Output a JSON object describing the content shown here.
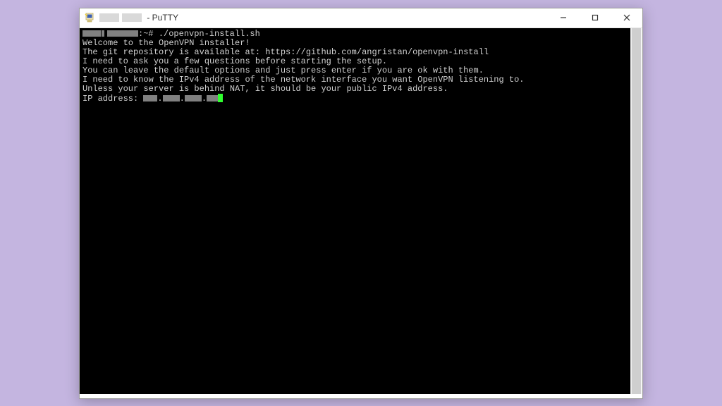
{
  "window": {
    "app_name": "PuTTY",
    "title_suffix": " - PuTTY"
  },
  "terminal": {
    "prompt_suffix": ":~# ",
    "command": "./openvpn-install.sh",
    "lines": [
      "Welcome to the OpenVPN installer!",
      "The git repository is available at: https://github.com/angristan/openvpn-install",
      "",
      "I need to ask you a few questions before starting the setup.",
      "You can leave the default options and just press enter if you are ok with them.",
      "",
      "I need to know the IPv4 address of the network interface you want OpenVPN listening to.",
      "Unless your server is behind NAT, it should be your public IPv4 address."
    ],
    "ip_prompt": "IP address: "
  }
}
